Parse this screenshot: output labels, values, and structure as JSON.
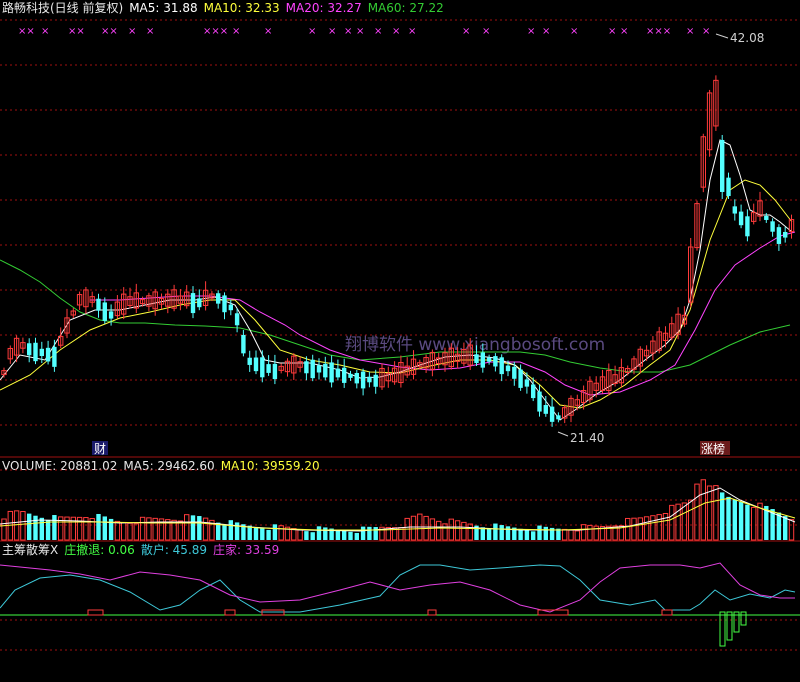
{
  "colors": {
    "bg": "#000000",
    "up": "#ff3b3b",
    "down": "#54ffff",
    "ma5": "#ffffff",
    "ma10": "#ffff3c",
    "ma20": "#ff44ff",
    "ma60": "#33cc33",
    "grid": "#a01010",
    "label": "#d0d0d0",
    "marker": "#ff44ff",
    "retail": "#3ec8d8",
    "dealer": "#e040e0",
    "withdraw": "#44ff44"
  },
  "header": {
    "title": "路畅科技(日线 前复权)",
    "ma5": "MA5: 31.88",
    "ma10": "MA10: 32.33",
    "ma20": "MA20: 32.27",
    "ma60": "MA60: 27.22"
  },
  "price_panel": {
    "high_label": "42.08",
    "low_label": "21.40",
    "watermark": "翔博软件 www.xiangbosoft.com",
    "tag_cai": "财",
    "tag_zhangbang": "涨榜",
    "marker_glyph": "××"
  },
  "volume_panel": {
    "volume": "VOLUME: 20881.02",
    "ma5": "MA5: 29462.60",
    "ma10": "MA10: 39559.20"
  },
  "indicator_panel": {
    "name": "主筹散筹X",
    "withdraw": "庄撤退: 0.06",
    "retail": "散户: 45.89",
    "dealer": "庄家: 33.59"
  },
  "chart_data": [
    {
      "type": "candlestick",
      "title": "路畅科技(日线 前复权)",
      "yhigh": 42.08,
      "ylow": 21.4,
      "indicators": {
        "MA5": 31.88,
        "MA10": 32.33,
        "MA20": 32.27,
        "MA60": 27.22
      }
    },
    {
      "type": "bar",
      "title": "VOLUME",
      "values": {
        "VOLUME": 20881.02,
        "MA5": 29462.6,
        "MA10": 39559.2
      }
    },
    {
      "type": "line",
      "title": "主筹散筹X",
      "values": {
        "庄撤退": 0.06,
        "散户": 45.89,
        "庄家": 33.59
      }
    }
  ]
}
